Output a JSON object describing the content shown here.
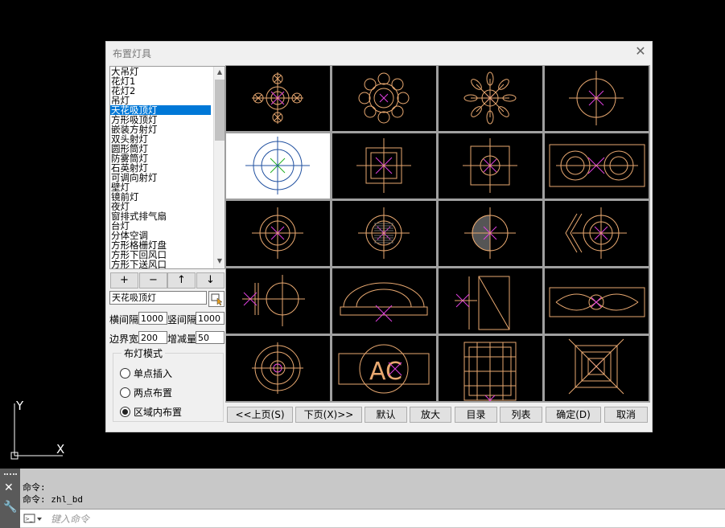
{
  "dialog": {
    "title": "布置灯具",
    "list_items": [
      "大吊灯",
      "花灯1",
      "花灯2",
      "吊灯",
      "天花吸顶灯",
      "方形吸顶灯",
      "嵌装方射灯",
      "双头射灯",
      "圆形筒灯",
      "防雾筒灯",
      "石英射灯",
      "可调向射灯",
      "壁灯",
      "镜前灯",
      "夜灯",
      "窗排式排气扇",
      "台灯",
      "分体空调",
      "方形格栅灯盘",
      "方形下回风口",
      "方形下送风口"
    ],
    "selected_index": 4,
    "buttons": {
      "add": "+",
      "remove": "−",
      "up": "↑",
      "down": "↓"
    },
    "name_value": "天花吸顶灯",
    "h_spacing_label": "横间隔",
    "h_spacing": "1000",
    "v_spacing_label": "竖间隔",
    "v_spacing": "1000",
    "border_label": "边界宽",
    "border": "200",
    "delta_label": "增减量",
    "delta": "50",
    "mode_title": "布灯模式",
    "modes": [
      "单点插入",
      "两点布置",
      "区域内布置"
    ],
    "selected_mode": 2,
    "nav": {
      "prev": "<<上页(S)",
      "next": "下页(X)>>",
      "default": "默认",
      "zoom": "放大",
      "catalog": "目录",
      "list": "列表",
      "ok": "确定(D)",
      "cancel": "取消"
    },
    "grid_selected": 4,
    "symbol_text": "AC"
  },
  "ucs": {
    "x": "X",
    "y": "Y"
  },
  "command": {
    "history": [
      "命令:",
      "命令: zhl_bd"
    ],
    "placeholder": "键入命令"
  },
  "colors": {
    "symbol": "#e8a870",
    "accent": "#e040e0",
    "selection": "#0078d7"
  }
}
